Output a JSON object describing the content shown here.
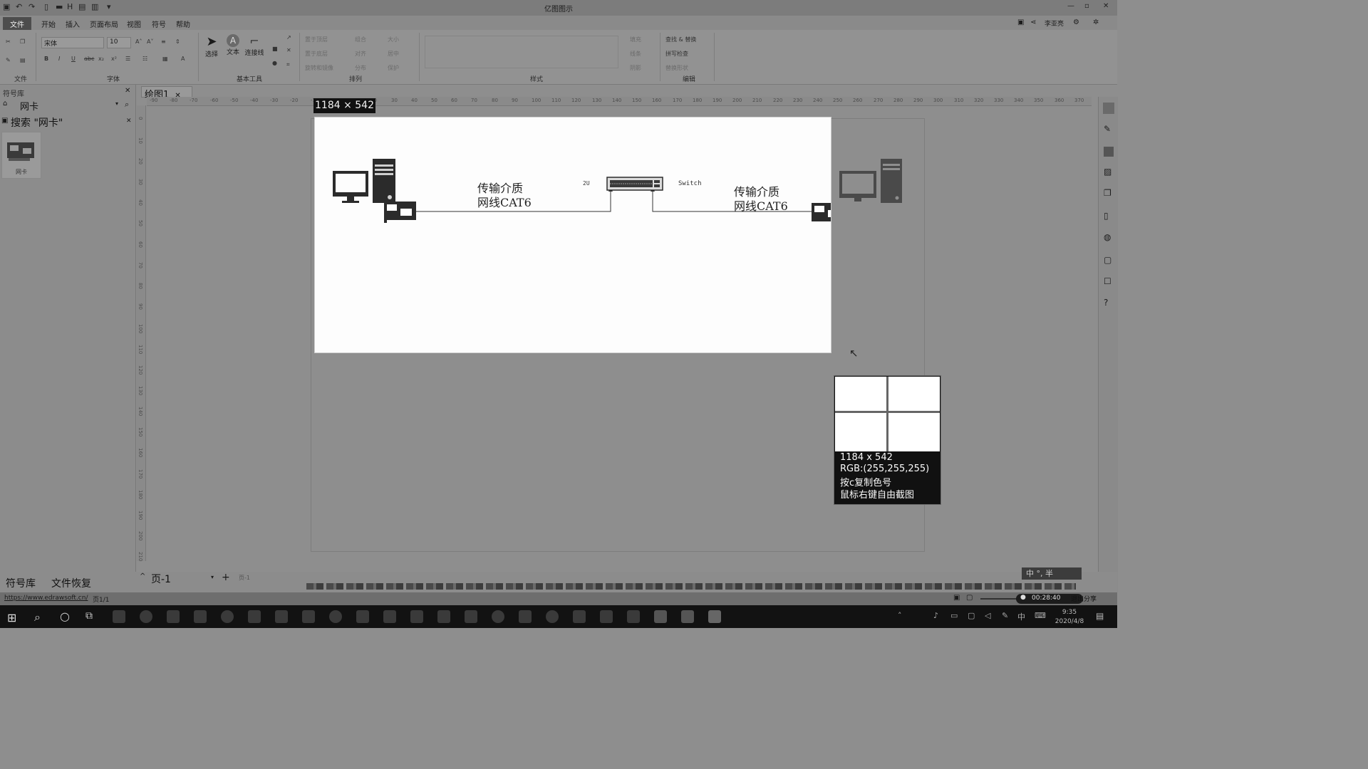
{
  "app": {
    "title": "亿图图示",
    "menu": [
      "文件",
      "开始",
      "插入",
      "页面布局",
      "视图",
      "符号",
      "帮助"
    ],
    "user": "李亚亮"
  },
  "ribbon": {
    "font_name": "宋体",
    "font_size": "10",
    "group_labels": [
      "文件",
      "字体",
      "基本工具",
      "排列",
      "样式",
      "编辑"
    ],
    "tools": [
      "选择",
      "文本",
      "连接线"
    ],
    "arrange": [
      "置于顶层",
      "组合",
      "大小",
      "置于底层",
      "对齐",
      "居中",
      "旋转和镜像",
      "分布",
      "保护"
    ],
    "style": [
      "填充",
      "线条",
      "阴影"
    ],
    "edit": [
      "查找 & 替换",
      "拼写检查",
      "替换形状"
    ]
  },
  "left_panel": {
    "title": "符号库",
    "library": "网卡",
    "search_header": "搜索 \"网卡\"",
    "item_label": "网卡",
    "bottom_tabs": [
      "符号库",
      "文件恢复"
    ]
  },
  "document": {
    "tab": "绘图1",
    "page_tab": "页-1",
    "page_tab2": "页-1",
    "ruler_h": [
      "-90",
      "-80",
      "-70",
      "-60",
      "-50",
      "-40",
      "-30",
      "-20",
      "-10",
      "0",
      "10",
      "20",
      "30",
      "40",
      "50",
      "60",
      "70",
      "80",
      "90",
      "100",
      "110",
      "120",
      "130",
      "140",
      "150",
      "160",
      "170",
      "180",
      "190",
      "200",
      "210",
      "220",
      "230",
      "240",
      "250",
      "260",
      "270",
      "280",
      "290",
      "300",
      "310",
      "320",
      "330",
      "340",
      "350",
      "360",
      "370"
    ],
    "ruler_v": [
      "0",
      "10",
      "20",
      "30",
      "40",
      "50",
      "60",
      "70",
      "80",
      "90",
      "100",
      "110",
      "120",
      "130",
      "140",
      "150",
      "160",
      "170",
      "180",
      "190",
      "200",
      "210"
    ]
  },
  "diagram": {
    "left_label_line1": "传输介质",
    "left_label_line2": "网线CAT6",
    "right_label_line1": "传输介质",
    "right_label_line2": "网线CAT6",
    "switch_port_label": "2U",
    "switch_label": "Switch"
  },
  "capture": {
    "dimension": "1184 × 542",
    "mag_dimension": "1184 x 542",
    "rgb": "RGB:(255,255,255)",
    "hint1": "按c复制色号",
    "hint2": "鼠标右键自由截图"
  },
  "status": {
    "url": "https://www.edrawsoft.cn/",
    "page": "页1/1",
    "timer": "00:28:40",
    "exit_share": "退出分享",
    "ime": "中 °, 半"
  },
  "taskbar": {
    "time": "9:35",
    "date": "2020/4/8"
  },
  "colors": {
    "chrome": "#8e8e8e",
    "canvas": "#fdfdfd",
    "taskbar": "#121212"
  }
}
